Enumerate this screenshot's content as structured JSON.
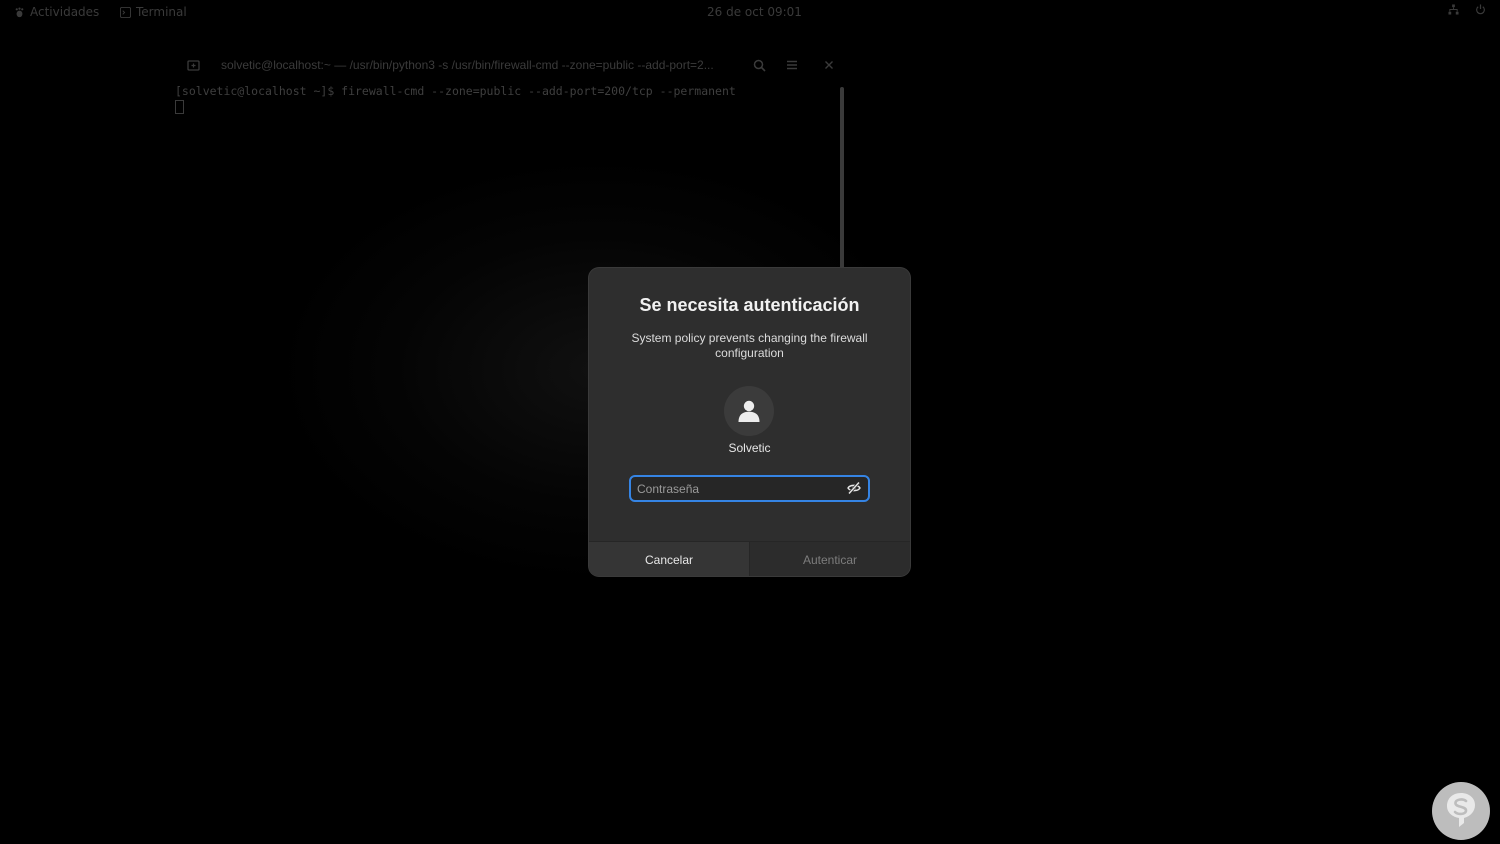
{
  "topbar": {
    "activities": "Actividades",
    "app": "Terminal",
    "clock": "26 de oct  09:01",
    "tray_icons": [
      "network-icon",
      "power-icon"
    ]
  },
  "terminal": {
    "title": "solvetic@localhost:~ — /usr/bin/python3 -s /usr/bin/firewall-cmd --zone=public --add-port=2...",
    "prompt_line": "[solvetic@localhost ~]$ firewall-cmd --zone=public --add-port=200/tcp --permanent"
  },
  "dialog": {
    "title": "Se necesita autenticación",
    "message": "System policy prevents changing the firewall configuration",
    "username": "Solvetic",
    "password": {
      "value": "",
      "placeholder": "Contraseña"
    },
    "cancel_label": "Cancelar",
    "authenticate_label": "Autenticar"
  },
  "colors": {
    "focus_ring": "#3584e4",
    "dialog_bg": "#2e2e2e",
    "watermark": "#bdbdbd"
  }
}
